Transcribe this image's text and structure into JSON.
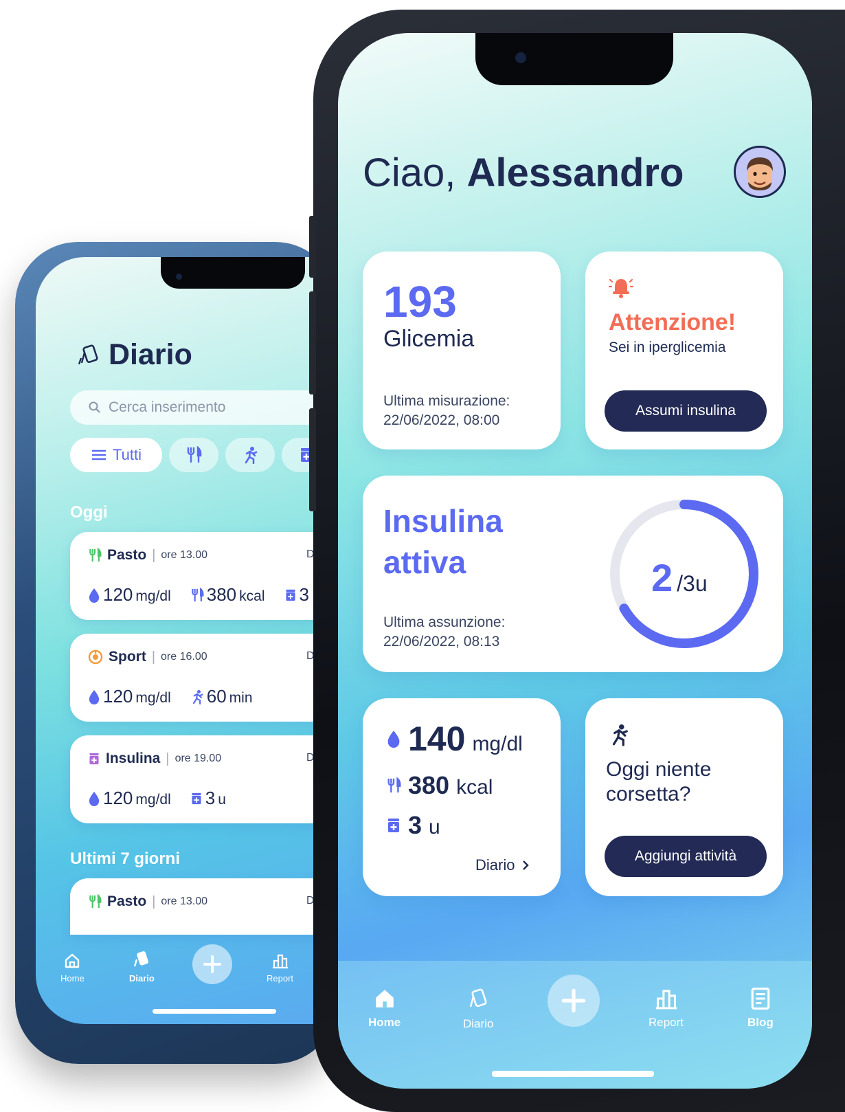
{
  "colors": {
    "accent": "#5b6af0",
    "navy": "#1f2a52",
    "alert": "#f26d55",
    "button": "#222a55"
  },
  "back_phone": {
    "title": "Diario",
    "search": {
      "placeholder": "Cerca inserimento"
    },
    "filters": [
      {
        "label": "Tutti",
        "icon": "list-icon",
        "active": true
      },
      {
        "icon": "fork-knife-icon"
      },
      {
        "icon": "running-icon"
      },
      {
        "icon": "insulin-pen-icon"
      }
    ],
    "sections": {
      "today": "Oggi",
      "last7": "Ultimi 7 giorni"
    },
    "entries": [
      {
        "type": "Pasto",
        "sep": "|",
        "time": "ore 13.00",
        "details": "Dett",
        "values": [
          {
            "num": "120",
            "unit": "mg/dl",
            "icon": "drop-icon"
          },
          {
            "num": "380",
            "unit": "kcal",
            "icon": "fork-knife-icon"
          },
          {
            "num": "3",
            "unit": "",
            "icon": "insulin-pen-icon"
          }
        ]
      },
      {
        "type": "Sport",
        "sep": "|",
        "time": "ore 16.00",
        "details": "Dett",
        "values": [
          {
            "num": "120",
            "unit": "mg/dl",
            "icon": "drop-icon"
          },
          {
            "num": "60",
            "unit": "min",
            "icon": "running-icon"
          }
        ]
      },
      {
        "type": "Insulina",
        "sep": "|",
        "time": "ore 19.00",
        "details": "Dett",
        "values": [
          {
            "num": "120",
            "unit": "mg/dl",
            "icon": "drop-icon"
          },
          {
            "num": "3",
            "unit": "u",
            "icon": "insulin-pen-icon"
          }
        ]
      },
      {
        "type": "Pasto",
        "sep": "|",
        "time": "ore 13.00",
        "details": "Dett"
      }
    ],
    "nav": [
      {
        "label": "Home",
        "icon": "home-icon"
      },
      {
        "label": "Diario",
        "icon": "diary-icon",
        "active": true
      },
      {
        "label": "",
        "icon": "plus-icon"
      },
      {
        "label": "Report",
        "icon": "report-icon"
      }
    ]
  },
  "front_phone": {
    "greeting": {
      "prefix": "Ciao,",
      "name": "Alessandro"
    },
    "glycemia": {
      "value": "193",
      "label": "Glicemia",
      "meta_label": "Ultima misurazione:",
      "meta_date": "22/06/2022, 08:00"
    },
    "alert": {
      "icon": "bell-icon",
      "title": "Attenzione!",
      "subtitle": "Sei in iperglicemia",
      "button": "Assumi insulina"
    },
    "insulin": {
      "title_line1": "Insulina",
      "title_line2": "attiva",
      "current": "2",
      "total_label": "/3u",
      "progress": 0.6667,
      "meta_label": "Ultima assunzione:",
      "meta_date": "22/06/2022, 08:13"
    },
    "summary": [
      {
        "num": "140",
        "unit": "mg/dl",
        "icon": "drop-icon"
      },
      {
        "num": "380",
        "unit": "kcal",
        "icon": "fork-knife-icon"
      },
      {
        "num": "3",
        "unit": "u",
        "icon": "insulin-pen-icon"
      }
    ],
    "summary_link": "Diario",
    "activity": {
      "icon": "running-icon",
      "text": "Oggi niente corsetta?",
      "button": "Aggiungi attività"
    },
    "nav": [
      {
        "label": "Home",
        "icon": "home-icon",
        "active": true
      },
      {
        "label": "Diario",
        "icon": "diary-icon"
      },
      {
        "label": "",
        "icon": "plus-icon"
      },
      {
        "label": "Report",
        "icon": "report-icon"
      },
      {
        "label": "Blog",
        "icon": "blog-icon"
      }
    ]
  }
}
